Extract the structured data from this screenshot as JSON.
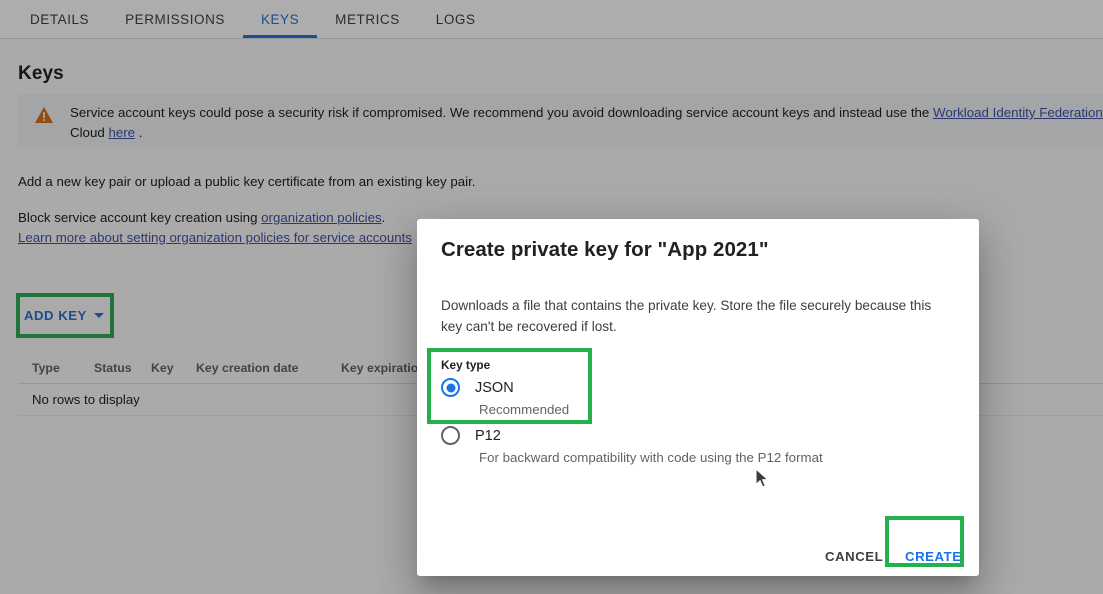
{
  "tabs": [
    {
      "label": "DETAILS",
      "active": false
    },
    {
      "label": "PERMISSIONS",
      "active": false
    },
    {
      "label": "KEYS",
      "active": true
    },
    {
      "label": "METRICS",
      "active": false
    },
    {
      "label": "LOGS",
      "active": false
    }
  ],
  "page": {
    "title": "Keys",
    "warning": {
      "icon": "warning-triangle-icon",
      "line1_pre": "Service account keys could pose a security risk if compromised. We recommend you avoid downloading service account keys and instead use the ",
      "line1_link": "Workload Identity Federation",
      "line1_post": " .",
      "line2_pre": "Cloud ",
      "line2_link": "here",
      "line2_post": " ."
    },
    "add_pair_text": "Add a new key pair or upload a public key certificate from an existing key pair.",
    "block_pre": "Block service account key creation using ",
    "block_link": "organization policies",
    "block_post": ".",
    "learn_more_link": "Learn more about setting organization policies for service accounts",
    "add_key_button": "ADD KEY",
    "table": {
      "headers": [
        "Type",
        "Status",
        "Key",
        "Key creation date",
        "Key expiration"
      ],
      "empty_message": "No rows to display",
      "rows": []
    }
  },
  "dialog": {
    "title": "Create private key for \"App 2021\"",
    "description": "Downloads a file that contains the private key. Store the file securely because this key can't be recovered if lost.",
    "key_type_label": "Key type",
    "options": [
      {
        "value": "JSON",
        "label": "JSON",
        "note": "Recommended",
        "selected": true
      },
      {
        "value": "P12",
        "label": "P12",
        "note": "For backward compatibility with code using the P12 format",
        "selected": false
      }
    ],
    "cancel_label": "CANCEL",
    "create_label": "CREATE"
  },
  "colors": {
    "highlight_green": "#22b14c",
    "link_blue": "#1a73e8",
    "anchor_indigo": "#3f51b5",
    "warning_orange": "#e8710a",
    "text_primary": "#202124",
    "text_secondary": "#5f6368",
    "page_bg": "#fafafa",
    "banner_bg": "#f1f3f4"
  }
}
